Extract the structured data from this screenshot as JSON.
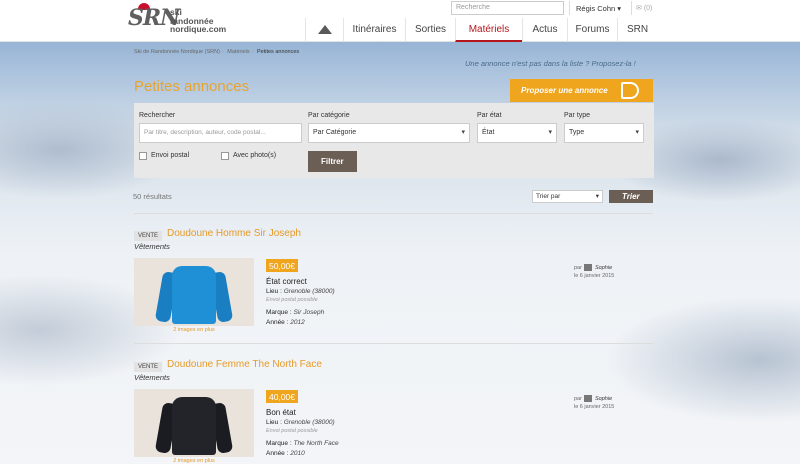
{
  "header": {
    "logo_mark": "SRN",
    "logo_lines": [
      "ski",
      "randonnée",
      "nordique.com"
    ],
    "search_placeholder": "Recherche",
    "user_name": "Régis Cohn ▾",
    "mail_count": "(0)",
    "nav": [
      "Itinéraires",
      "Sorties",
      "Matériels",
      "Actus",
      "Forums",
      "SRN"
    ],
    "active_nav": "Matériels"
  },
  "breadcrumb": [
    "Ski de Randonnée Nordique (SRN)",
    "Matériels",
    "Petites annonces"
  ],
  "page": {
    "missing_text": "Une annonce n'est pas dans la liste ? Proposez-la !",
    "title": "Petites annonces",
    "propose_button": "Proposer une annonce"
  },
  "filters": {
    "search_label": "Rechercher",
    "search_placeholder": "Par titre, description, auteur, code postal...",
    "category_label": "Par catégorie",
    "category_value": "Par Catégorie",
    "state_label": "Par état",
    "state_value": "État",
    "type_label": "Par type",
    "type_value": "Type",
    "shipping_label": "Envoi postal",
    "photo_label": "Avec photo(s)",
    "filter_button": "Filtrer"
  },
  "results": {
    "count": "50 résultats",
    "sort_value": "Trier par",
    "sort_button": "Trier"
  },
  "listings": [
    {
      "badge": "VENTE",
      "title": "Doudoune Homme Sir Joseph",
      "category": "Vêtements",
      "price": "50,00€",
      "condition": "État correct",
      "place_label": "Lieu :",
      "place": "Grenoble (38000)",
      "shipping": "Envoi postal possible",
      "brand_label": "Marque :",
      "brand": "Sir Joseph",
      "year_label": "Année :",
      "year": "2012",
      "photos": "2 images en plus",
      "by_label": "par",
      "author": "Sophie",
      "date": "le 6 janvier 2015",
      "color": "#1f8fd6"
    },
    {
      "badge": "VENTE",
      "title": "Doudoune Femme The North Face",
      "category": "Vêtements",
      "price": "40,00€",
      "condition": "Bon état",
      "place_label": "Lieu :",
      "place": "Grenoble (38000)",
      "shipping": "Envoi postal possible",
      "brand_label": "Marque :",
      "brand": "The North Face",
      "year_label": "Année :",
      "year": "2010",
      "photos": "2 images en plus",
      "by_label": "par",
      "author": "Sophie",
      "date": "le 6 janvier 2015",
      "color": "#23242a"
    }
  ]
}
